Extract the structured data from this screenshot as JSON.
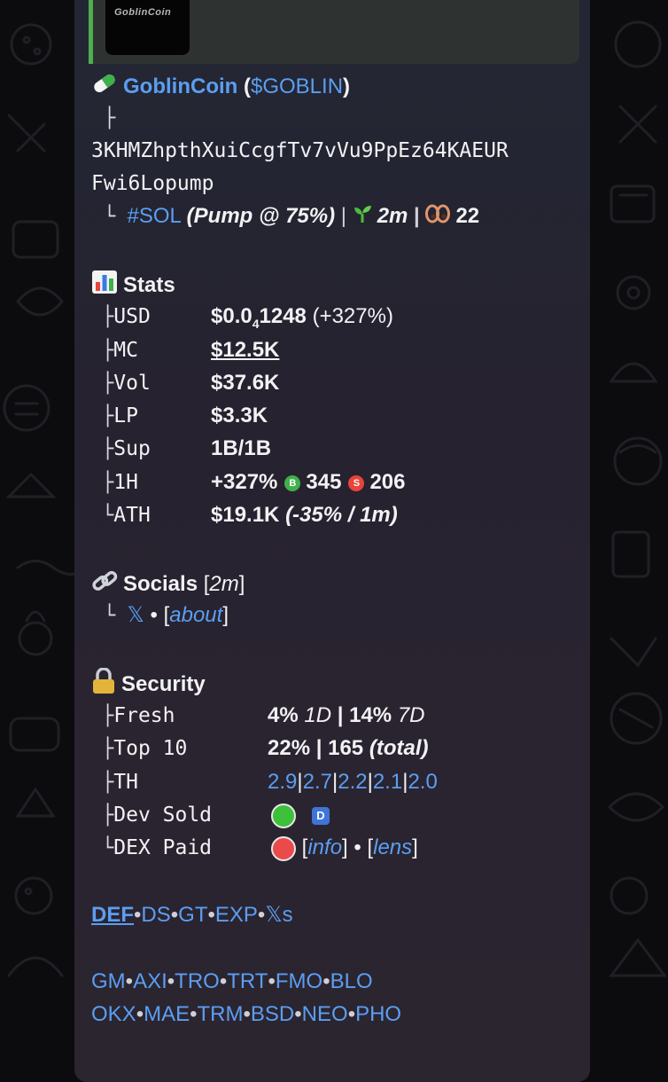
{
  "preview": {
    "thumb_text": "GoblinCoin"
  },
  "token": {
    "name": "GoblinCoin",
    "ticker": "$GOBLIN",
    "address_line1": "3KHMZhpthXuiCcgfTv7vVu9PpEz64KAEUR",
    "address_line2": "Fwi6Lopump",
    "chain": "#SOL",
    "pump": "(Pump @ ",
    "pump_pct": "75%",
    "pump_close": ")",
    "age": "2m",
    "holders_count": "22"
  },
  "stats": {
    "heading": "Stats",
    "rows": [
      {
        "label": "USD",
        "value": "$0.0",
        "sub": "4",
        "value_rest": "1248",
        "extra": " (+327%)"
      },
      {
        "label": "MC",
        "value": "$12.5K"
      },
      {
        "label": "Vol",
        "value": "$37.6K"
      },
      {
        "label": "LP",
        "value": "$3.3K"
      },
      {
        "label": "Sup",
        "value": "1B/1B"
      },
      {
        "label": "1H",
        "value": "+327%",
        "buy_badge": "B",
        "buys": "345",
        "sell_badge": "S",
        "sells": "206"
      },
      {
        "label": "ATH",
        "value": "$19.1K",
        "extra": "(-35% / 1m)"
      }
    ]
  },
  "socials": {
    "heading": "Socials",
    "age": "2m",
    "x_icon": "𝕏",
    "about": "about"
  },
  "security": {
    "heading": "Security",
    "fresh_label": "Fresh",
    "fresh_1d": "4%",
    "fresh_1d_unit": "1D",
    "fresh_7d": "14%",
    "fresh_7d_unit": "7D",
    "top10_label": "Top 10",
    "top10_pct": "22%",
    "top10_total": "165",
    "top10_total_label": "(total)",
    "th_label": "TH",
    "th_values": [
      "2.9",
      "2.7",
      "2.2",
      "2.1",
      "2.0"
    ],
    "dev_sold_label": "Dev Sold",
    "dev_badge": "D",
    "dex_paid_label": "DEX Paid",
    "info": "info",
    "lens": "lens",
    "status_colors": {
      "yes": "#3ec03b",
      "no": "#ea4a4a"
    }
  },
  "links": {
    "row1": [
      "DEF",
      "DS",
      "GT",
      "EXP",
      "𝕏s"
    ],
    "row2": [
      "GM",
      "AXI",
      "TRO",
      "TRT",
      "FMO",
      "BLO"
    ],
    "row3": [
      "OKX",
      "MAE",
      "TRM",
      "BSD",
      "NEO",
      "PHO"
    ]
  },
  "colors": {
    "link": "#5b9ef2",
    "bubble": "#262431",
    "accent_bar": "#4fae4e"
  }
}
